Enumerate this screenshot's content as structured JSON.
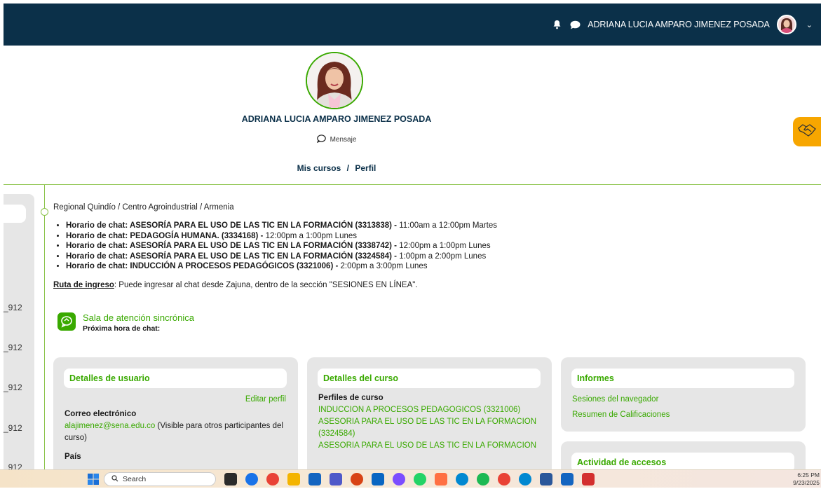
{
  "header": {
    "user_name": "ADRIANA LUCIA AMPARO JIMENEZ POSADA"
  },
  "profile": {
    "name": "ADRIANA LUCIA AMPARO JIMENEZ POSADA",
    "message_label": "Mensaje",
    "breadcrumb": {
      "first": "Mis cursos",
      "separator": "/",
      "second": "Perfil"
    }
  },
  "sidebar": {
    "items": [
      "_912",
      "_912",
      "_912",
      "_912",
      "_912"
    ]
  },
  "main": {
    "region": "Regional Quindío / Centro Agroindustrial / Armenia",
    "schedules": [
      {
        "label": "Horario de chat: ASESORÍA PARA EL USO DE LAS TIC EN LA FORMACIÓN (3313838) -",
        "time": " 11:00am a 12:00pm Martes"
      },
      {
        "label": "Horario de chat: PEDAGOGÍA HUMANA. (3334168) -",
        "time": " 12:00pm a 1:00pm Lunes"
      },
      {
        "label": "Horario de chat: ASESORÍA PARA EL USO DE LAS TIC EN LA FORMACIÓN (3338742) -",
        "time": " 12:00pm a 1:00pm Lunes"
      },
      {
        "label": "Horario de chat: ASESORÍA PARA EL USO DE LAS TIC EN LA FORMACIÓN (3324584) -",
        "time": " 1:00pm a 2:00pm Lunes"
      },
      {
        "label": "Horario de chat: INDUCCIÓN A PROCESOS PEDAGÓGICOS (3321006) -",
        "time": " 2:00pm a 3:00pm Lunes"
      }
    ],
    "ruta_label": "Ruta de ingreso",
    "ruta_text": ": Puede ingresar al chat desde Zajuna, dentro de la sección \"SESIONES EN LÍNEA\".",
    "sala_link": "Sala de atención sincrónica",
    "sala_sub": "Próxima hora de chat:"
  },
  "user_details": {
    "title": "Detalles de usuario",
    "edit_label": "Editar perfil",
    "email_label": "Correo electrónico",
    "email": "alajimenez@sena.edu.co",
    "email_note": " (Visible para otros participantes del curso)",
    "country_label": "País"
  },
  "course_details": {
    "title": "Detalles del curso",
    "profiles_label": "Perfiles de curso",
    "courses": [
      "INDUCCION A PROCESOS PEDAGOGICOS (3321006)",
      "ASESORIA PARA EL USO DE LAS TIC EN LA FORMACION (3324584)",
      "ASESORIA PARA EL USO DE LAS TIC EN LA FORMACION"
    ]
  },
  "reports": {
    "title": "Informes",
    "links": [
      "Sesiones del navegador",
      "Resumen de Calificaciones"
    ]
  },
  "access": {
    "title": "Actividad de accesos"
  },
  "taskbar": {
    "search_placeholder": "Search",
    "time": "6:25 PM",
    "date": "9/23/2025"
  },
  "colors": {
    "topbar": "#0b3049",
    "accent_green": "#39a900",
    "card_bg": "#e6e6e6",
    "handshake": "#f7a600"
  }
}
